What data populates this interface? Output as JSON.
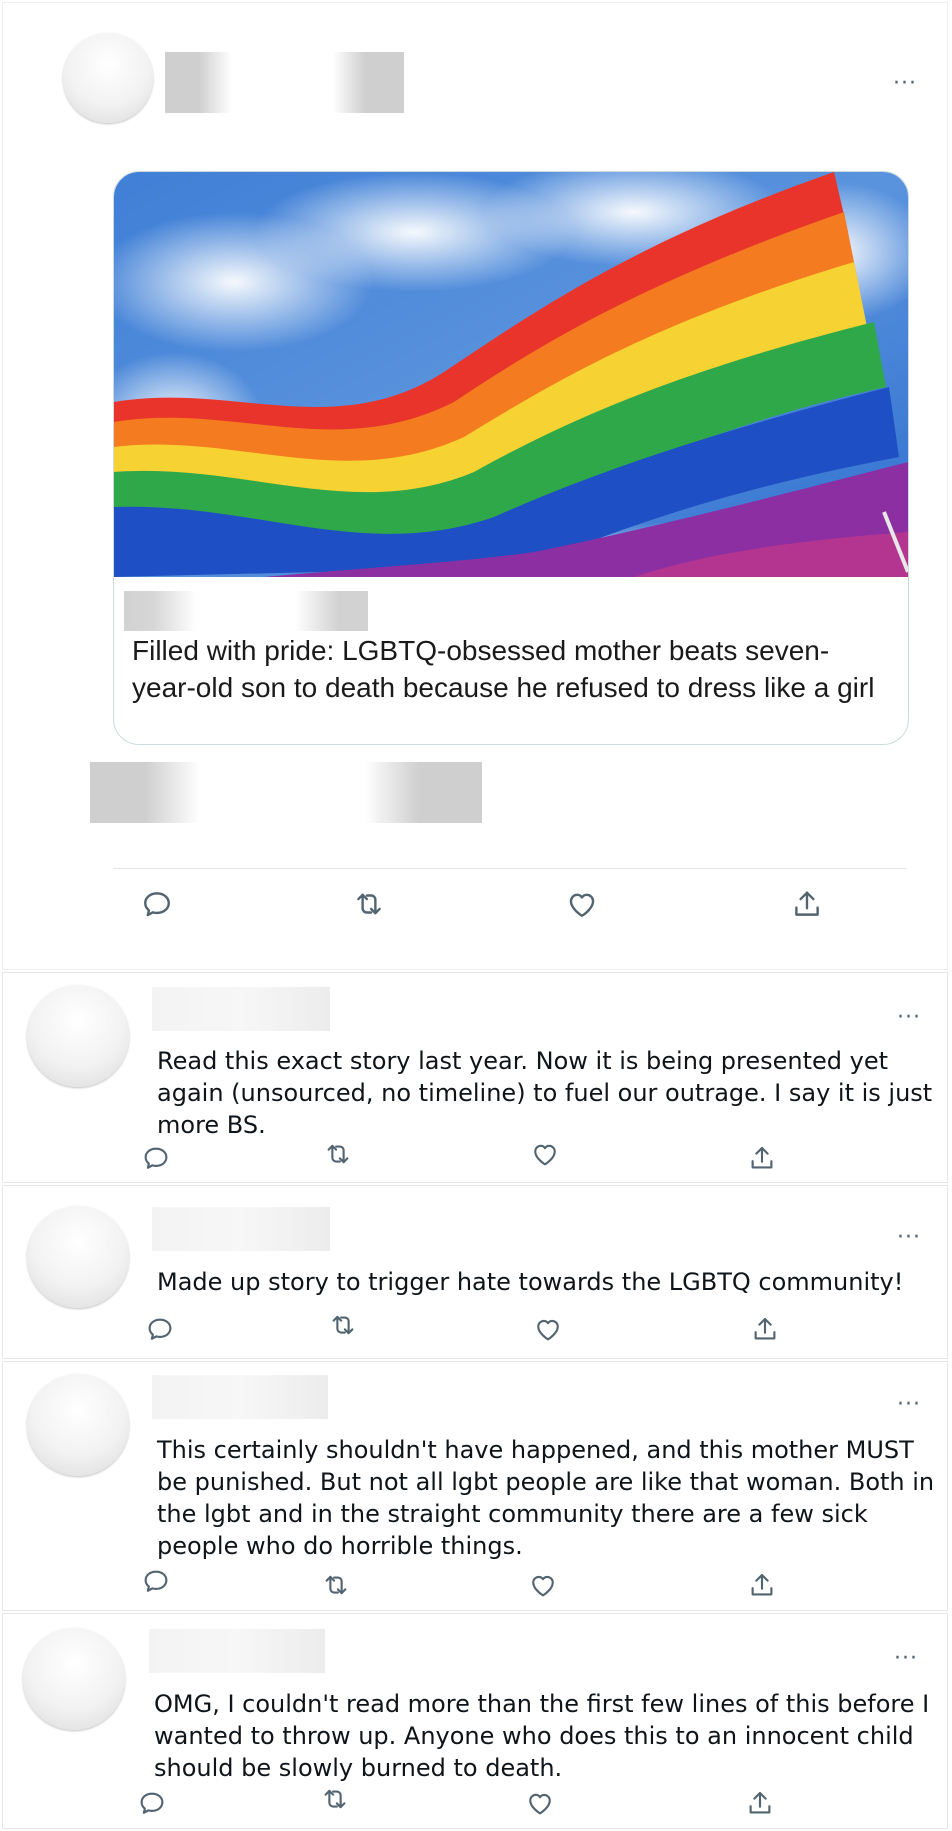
{
  "main_post": {
    "more_label": "···",
    "link_card": {
      "headline": "Filled with pride: LGBTQ-obsessed mother beats seven-year-old son to death because he refused to dress like a girl"
    },
    "actions": [
      "reply-icon",
      "retweet-icon",
      "like-icon",
      "share-icon"
    ]
  },
  "replies": [
    {
      "more_label": "···",
      "text": "Read this exact story last year. Now it is being presented yet again (unsourced, no timeline) to fuel our outrage. I say it is just more BS."
    },
    {
      "more_label": "···",
      "text": "Made up story to trigger hate towards the LGBTQ community!"
    },
    {
      "more_label": "···",
      "text": "This certainly shouldn't have happened, and this mother MUST be punished. But not all lgbt people are like that woman. Both in the lgbt and in the straight community there are a few sick people who do horrible things."
    },
    {
      "more_label": "···",
      "text": "OMG, I couldn't read more than the first few lines of this before I wanted to throw up. Anyone who does this to an innocent child should be slowly burned to death."
    }
  ],
  "colors": {
    "icon": "#536471",
    "border": "#e6e6e6",
    "text": "#0f1419"
  }
}
